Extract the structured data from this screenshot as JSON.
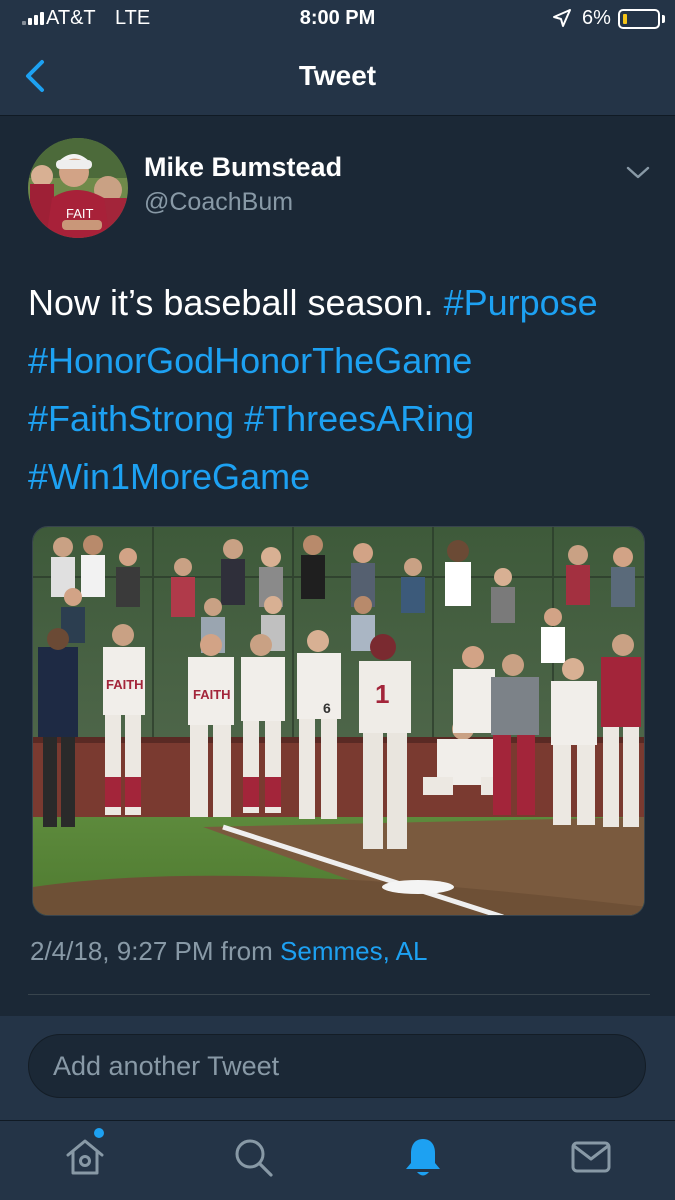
{
  "status_bar": {
    "carrier": "AT&T",
    "network": "LTE",
    "time": "8:00 PM",
    "battery_percent": "6%",
    "battery_level": 0.06,
    "signal_bars": 4,
    "icons": [
      "signal-icon",
      "location-arrow-icon",
      "battery-icon"
    ]
  },
  "nav": {
    "title": "Tweet",
    "back_icon": "chevron-left-icon"
  },
  "tweet": {
    "author_name": "Mike Bumstead",
    "author_handle": "@CoachBum",
    "text_lead": "Now it’s baseball season.",
    "hashtags": [
      "#Purpose",
      "#HonorGodHonorTheGame",
      "#FaithStrong",
      "#ThreesARing",
      "#Win1MoreGame"
    ],
    "date_time": "2/4/18, 9:27 PM",
    "from_word": "from",
    "location": "Semmes, AL",
    "more_icon": "chevron-down-icon"
  },
  "reply": {
    "placeholder": "Add another Tweet"
  },
  "tab_bar": {
    "tabs": [
      "home-icon",
      "search-icon",
      "notifications-icon",
      "messages-icon"
    ],
    "active_tab": "notifications-icon"
  },
  "colors": {
    "background": "#1b2836",
    "bar": "#243447",
    "accent": "#1da1f2",
    "secondary_text": "#8899a6"
  }
}
